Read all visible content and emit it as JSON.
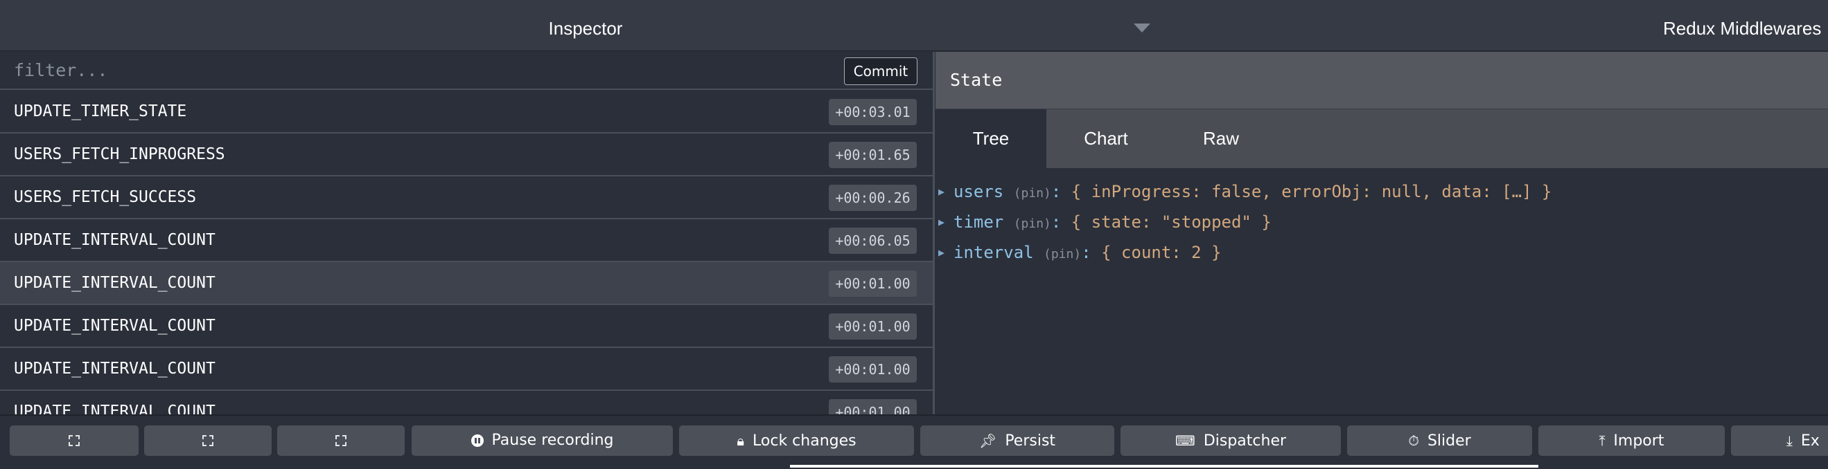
{
  "header": {
    "monitor_title": "Inspector",
    "right_monitor": "Redux Middlewares"
  },
  "left": {
    "filter_placeholder": "filter...",
    "commit_label": "Commit",
    "actions": [
      {
        "name": "UPDATE_TIMER_STATE",
        "time": "+00:03.01"
      },
      {
        "name": "USERS_FETCH_INPROGRESS",
        "time": "+00:01.65"
      },
      {
        "name": "USERS_FETCH_SUCCESS",
        "time": "+00:00.26"
      },
      {
        "name": "UPDATE_INTERVAL_COUNT",
        "time": "+00:06.05"
      },
      {
        "name": "UPDATE_INTERVAL_COUNT",
        "time": "+00:01.00"
      },
      {
        "name": "UPDATE_INTERVAL_COUNT",
        "time": "+00:01.00"
      },
      {
        "name": "UPDATE_INTERVAL_COUNT",
        "time": "+00:01.00"
      },
      {
        "name": "UPDATE_INTERVAL_COUNT",
        "time": "+00:01.00"
      }
    ],
    "selected_index": 4
  },
  "right": {
    "state_title": "State",
    "tabs": [
      {
        "label": "Tree"
      },
      {
        "label": "Chart"
      },
      {
        "label": "Raw"
      }
    ],
    "active_tab": "Tree",
    "tree": [
      {
        "key": "users",
        "pin": "(pin)",
        "value": "{ inProgress: false, errorObj: null, data: […] }"
      },
      {
        "key": "timer",
        "pin": "(pin)",
        "value": "{ state: \"stopped\" }"
      },
      {
        "key": "interval",
        "pin": "(pin)",
        "value": "{ count: 2 }"
      }
    ]
  },
  "toolbar": {
    "buttons": [
      {
        "label": "",
        "icon": "dock-left-icon"
      },
      {
        "label": "",
        "icon": "dock-right-icon"
      },
      {
        "label": "",
        "icon": "dock-bottom-icon"
      },
      {
        "label": "Pause recording",
        "icon": "pause-icon"
      },
      {
        "label": "Lock changes",
        "icon": "lock-icon"
      },
      {
        "label": "Persist",
        "icon": "pin-icon"
      },
      {
        "label": "Dispatcher",
        "icon": "keyboard-icon"
      },
      {
        "label": "Slider",
        "icon": "stopwatch-icon"
      },
      {
        "label": "Import",
        "icon": "upload-icon"
      },
      {
        "label": "Ex",
        "icon": "download-icon"
      }
    ]
  }
}
